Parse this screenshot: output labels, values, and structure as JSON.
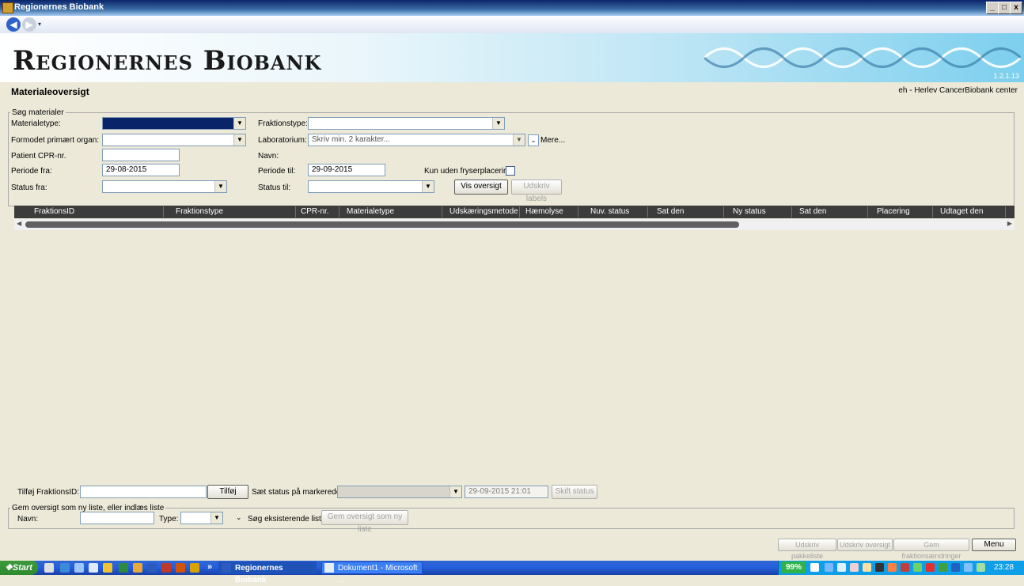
{
  "window": {
    "title": "Regionernes Biobank",
    "min": "_",
    "max": "□",
    "close": "x"
  },
  "banner": {
    "logo": "Regionernes Biobank",
    "version": "1.2.1.13"
  },
  "header": {
    "page_title": "Materialeoversigt",
    "user_info": "eh - Herlev CancerBiobank center"
  },
  "search": {
    "legend": "Søg materialer",
    "materialetype_label": "Materialetype:",
    "fraktionstype_label": "Fraktionstype:",
    "organ_label": "Formodet primært organ:",
    "laboratorium_label": "Laboratorium:",
    "laboratorium_placeholder": "Skriv min. 2 karakter...",
    "mere_label": "Mere...",
    "cpr_label": "Patient CPR-nr.",
    "navn_label": "Navn:",
    "periode_fra_label": "Periode fra:",
    "periode_fra_value": "29-08-2015",
    "periode_til_label": "Periode til:",
    "periode_til_value": "29-09-2015",
    "kun_uden_label": "Kun uden fryserplacering:",
    "status_fra_label": "Status fra:",
    "status_til_label": "Status til:",
    "vis_oversigt": "Vis oversigt",
    "udskriv_labels": "Udskriv labels"
  },
  "grid": {
    "columns": [
      "FraktionsID",
      "Fraktionstype",
      "CPR-nr.",
      "Materialetype",
      "Udskæringsmetode",
      "Hæmolyse",
      "Nuv. status",
      "Sat den",
      "Ny status",
      "Sat den",
      "Placering",
      "Udtaget den"
    ]
  },
  "bottom": {
    "tilfoj_label": "Tilføj FraktionsID:",
    "tilfoj_button": "Tilføj",
    "saet_status_label": "Sæt status på markerede:",
    "datetime_value": "29-09-2015 21:01",
    "skift_status": "Skift status",
    "gem_legend": "Gem oversigt som ny liste, eller indlæs liste",
    "navn_label": "Navn:",
    "type_label": "Type:",
    "sog_label": "Søg eksisterende liste",
    "gem_button": "Gem oversigt som ny liste"
  },
  "footer": {
    "udskriv_pakkeliste": "Udskriv pakkeliste",
    "udskriv_oversigt": "Udskriv oversigt",
    "gem_fraktionsaendringer": "Gem fraktionsændringer",
    "menu": "Menu"
  },
  "taskbar": {
    "start": "Start",
    "task1": "Regionernes Biobank",
    "task2": "Dokument1 - Microsoft ...",
    "battery": "99%",
    "clock": "23:28",
    "more": "»"
  }
}
